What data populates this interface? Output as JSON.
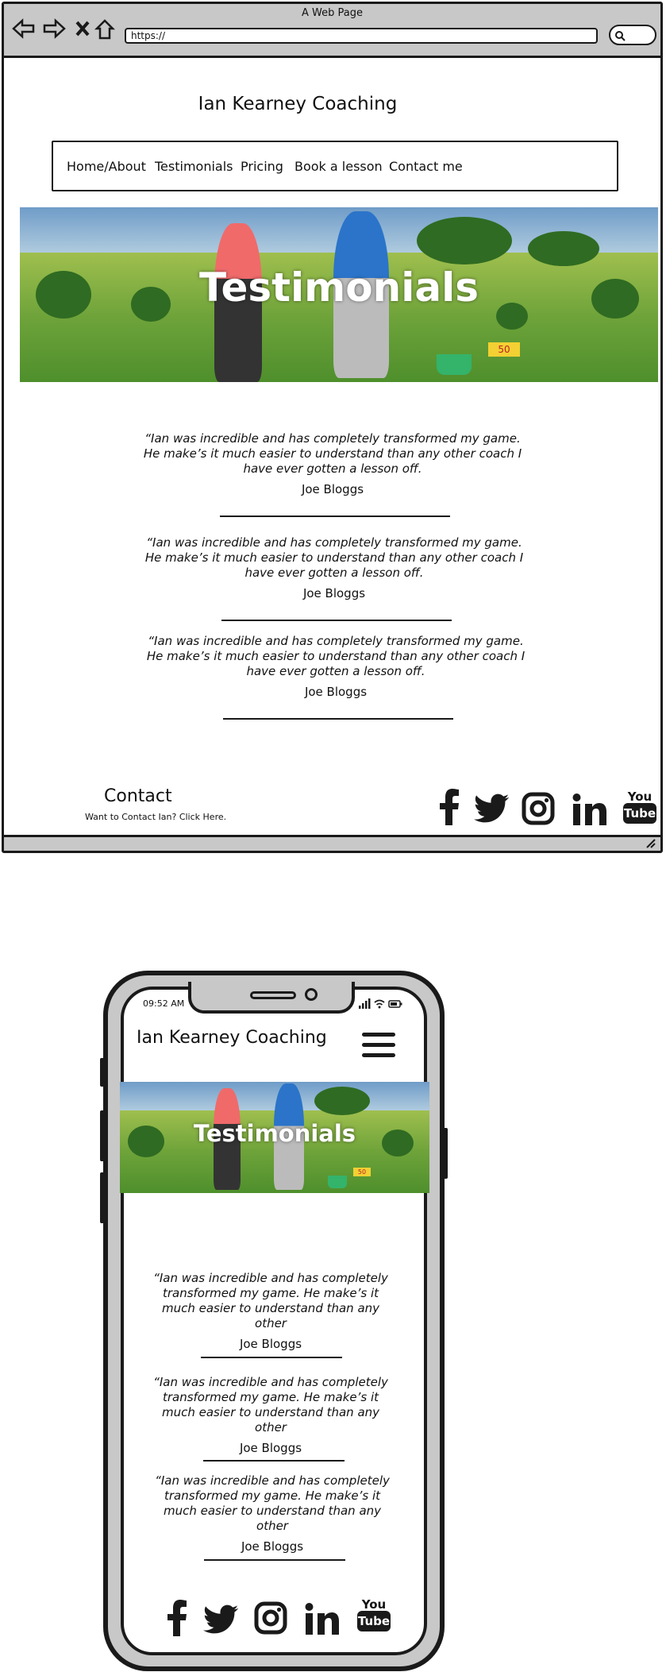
{
  "browser": {
    "window_title": "A Web Page",
    "url": "https://"
  },
  "site": {
    "title": "Ian Kearney Coaching",
    "nav": [
      "Home/About",
      "Testimonials",
      "Pricing",
      "Book a lesson",
      "Contact me"
    ],
    "hero_title": "Testimonials",
    "hero_sign": "50"
  },
  "desktop": {
    "testimonials": [
      {
        "quote": "“Ian was incredible and has completely transformed my game. He make’s it much easier to understand than any other coach I have ever gotten a lesson off.",
        "author": "Joe Bloggs"
      },
      {
        "quote": "“Ian was incredible and has completely transformed my game. He make’s it much easier to understand than any other coach I have ever gotten a lesson off.",
        "author": "Joe Bloggs"
      },
      {
        "quote": "“Ian was incredible and has completely transformed my game. He make’s it much easier to understand than any other coach I have ever gotten a lesson off.",
        "author": "Joe Bloggs"
      }
    ],
    "contact": {
      "heading": "Contact",
      "link": "Want to Contact Ian? Click Here."
    }
  },
  "mobile": {
    "status_time": "09:52 AM",
    "testimonials": [
      {
        "quote": "“Ian was incredible and has completely transformed my game. He make’s it much easier to understand than any other",
        "author": "Joe Bloggs"
      },
      {
        "quote": "“Ian was incredible and has completely transformed my game. He make’s it much easier to understand than any other",
        "author": "Joe Bloggs"
      },
      {
        "quote": "“Ian was incredible and has completely transformed my game. He make’s it much easier to understand than any other",
        "author": "Joe Bloggs"
      }
    ]
  },
  "social": {
    "icons": [
      "facebook-icon",
      "twitter-icon",
      "instagram-icon",
      "linkedin-icon",
      "youtube-icon"
    ],
    "youtube_top": "You",
    "youtube_bottom": "Tube"
  },
  "colors": {
    "wireframe_gray": "#c8c8c8",
    "ink": "#1a1a1a",
    "hero_sky": "#6f9cc8",
    "hero_grass": "#6ea33a"
  }
}
